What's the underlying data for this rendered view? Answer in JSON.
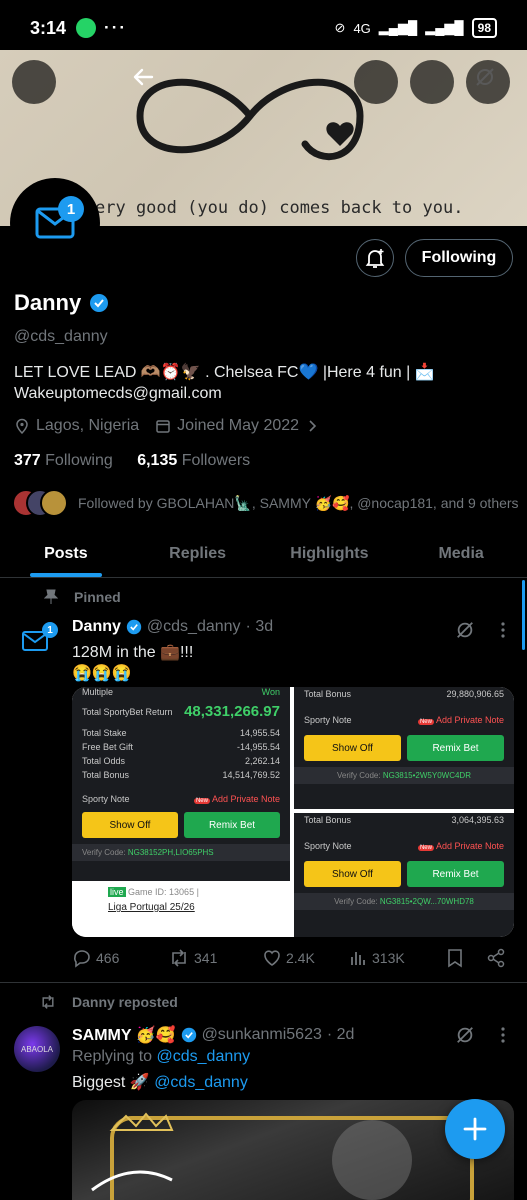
{
  "status_bar": {
    "time": "3:14",
    "dots": "···",
    "network": "4G",
    "battery": "98"
  },
  "banner": {
    "text": "ery good (you do) comes back to you."
  },
  "profile": {
    "message_badge": "1",
    "following_button": "Following",
    "name": "Danny",
    "handle": "@cds_danny",
    "bio_line1": "LET LOVE LEAD 🫶🏽⏰🦅 . Chelsea FC💙 |Here 4 fun | 📩",
    "bio_line2": "Wakeuptomecds@gmail.com",
    "location": "Lagos, Nigeria",
    "joined": "Joined May 2022",
    "following_count": "377",
    "following_label": "Following",
    "followers_count": "6,135",
    "followers_label": "Followers",
    "followed_by": "Followed by GBOLAHAN🗽, SAMMY 🥳🥰, @nocap181, and 9 others"
  },
  "tabs": [
    {
      "label": "Posts"
    },
    {
      "label": "Replies"
    },
    {
      "label": "Highlights"
    },
    {
      "label": "Media"
    }
  ],
  "post1": {
    "pinned_label": "Pinned",
    "avatar_badge": "1",
    "name": "Danny",
    "handle": "@cds_danny",
    "time": "· 3d",
    "text_line1": "128M in the 💼!!!",
    "text_line2": "😭😭😭",
    "slip_left": {
      "partial_header": "Multiple",
      "won": "Won",
      "return_label": "Total SportyBet Return",
      "return_value": "48,331,266.97",
      "rows": [
        {
          "label": "Total Stake",
          "value": "14,955.54"
        },
        {
          "label": "Free Bet Gift",
          "value": "-14,955.54"
        },
        {
          "label": "Total Odds",
          "value": "2,262.14"
        },
        {
          "label": "Total Bonus",
          "value": "14,514,769.52"
        }
      ],
      "note_label": "Sporty Note",
      "private_note": "Add Private Note",
      "new": "New",
      "show_off": "Show Off",
      "remix": "Remix Bet",
      "verify_label": "Verify Code:",
      "verify_code": "NG38152PH,LIO65PHS",
      "live": "live",
      "game_id": "Game ID: 13065 |",
      "league": "Liga Portugal 25/26"
    },
    "slip_right_top": {
      "bonus_label": "Total Bonus",
      "bonus_value": "29,880,906.65",
      "note_label": "Sporty Note",
      "private_note": "Add Private Note",
      "new": "New",
      "show_off": "Show Off",
      "remix": "Remix Bet",
      "verify_label": "Verify Code:",
      "verify_code": "NG3815•2W5Y0WC4DR"
    },
    "slip_right_bottom": {
      "bonus_label": "Total Bonus",
      "bonus_value": "3,064,395.63",
      "note_label": "Sporty Note",
      "private_note": "Add Private Note",
      "new": "New",
      "show_off": "Show Off",
      "remix": "Remix Bet",
      "verify_label": "Verify Code:",
      "verify_code": "NG3815•2QW...70WHD78"
    },
    "replies": "466",
    "reposts": "341",
    "likes": "2.4K",
    "views": "313K"
  },
  "post2": {
    "repost_label": "Danny reposted",
    "avatar_text": "ABAOLA",
    "name": "SAMMY 🥳🥰",
    "handle": "@sunkanmi5623",
    "time": "· 2d",
    "replying_label": "Replying to",
    "replying_handle": "@cds_danny",
    "text_prefix": "Biggest 🚀",
    "text_mention": "@cds_danny"
  },
  "colors": {
    "accent": "#1d9bf0",
    "background": "#000000",
    "muted": "#71767b"
  }
}
